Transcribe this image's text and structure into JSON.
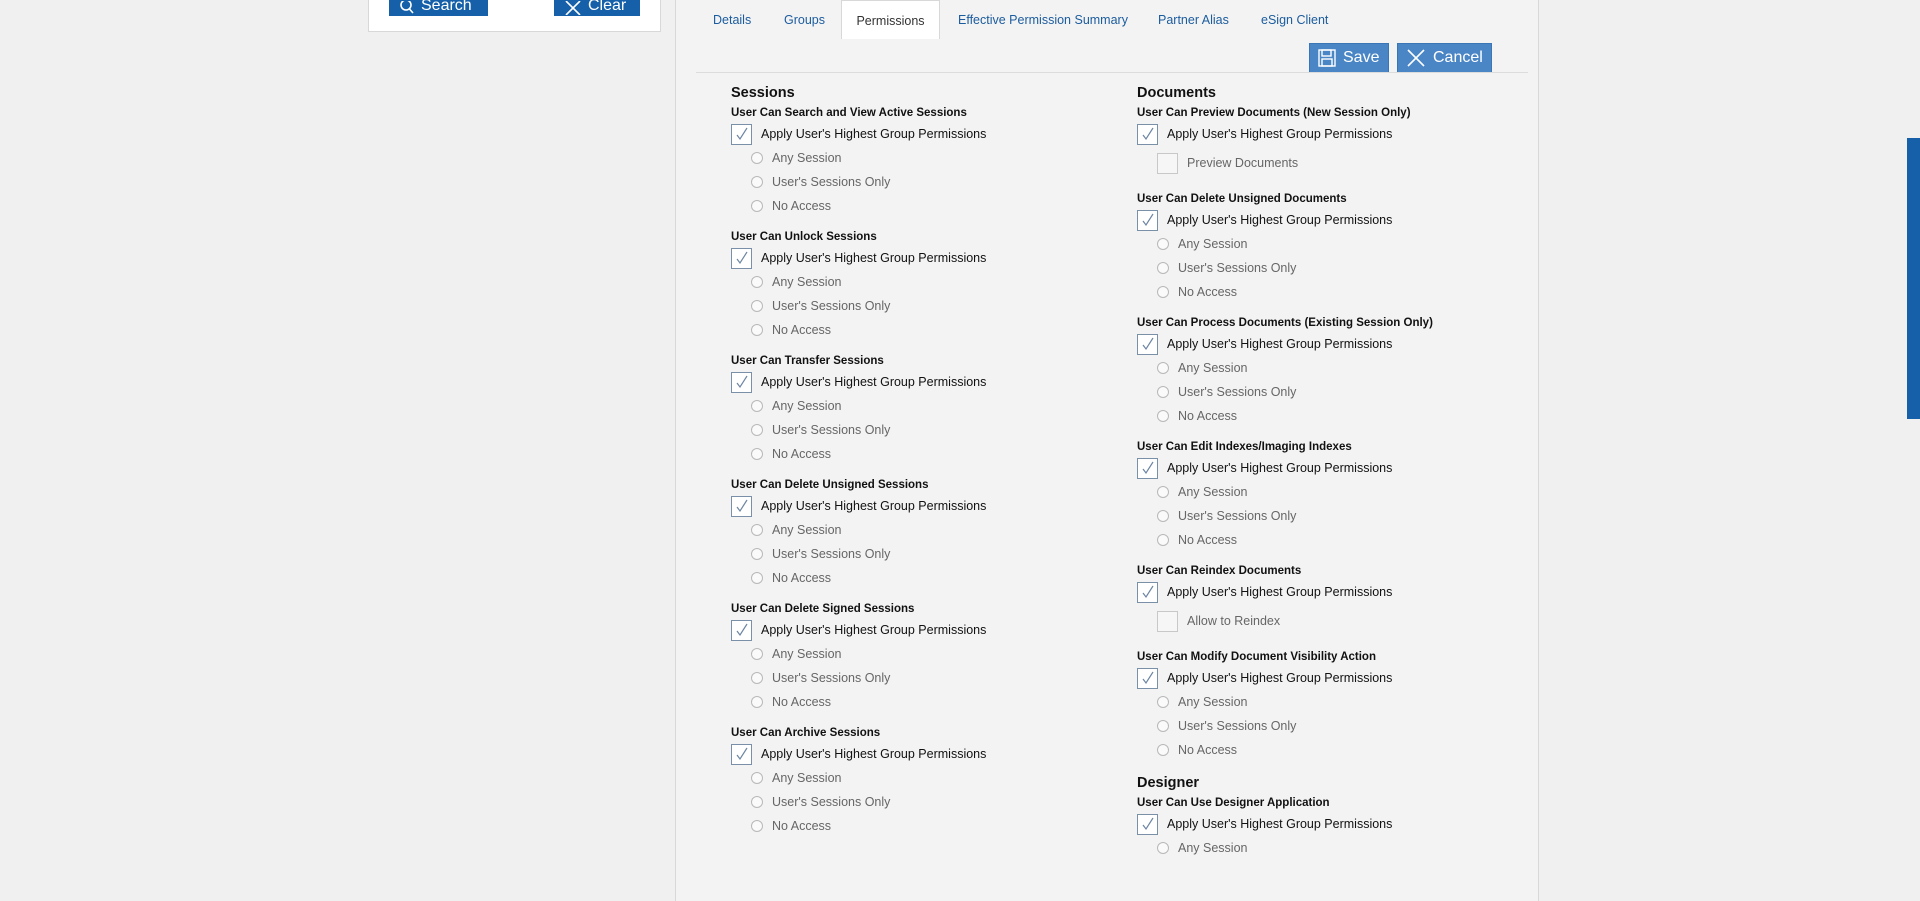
{
  "left_panel": {
    "search_label": "Search",
    "clear_label": "Clear"
  },
  "tabs": [
    {
      "label": "Details"
    },
    {
      "label": "Groups"
    },
    {
      "label": "Permissions"
    },
    {
      "label": "Effective Permission Summary"
    },
    {
      "label": "Partner Alias"
    },
    {
      "label": "eSign Client"
    }
  ],
  "actions": {
    "save_label": "Save",
    "cancel_label": "Cancel"
  },
  "common": {
    "apply_label": "Apply User's Highest Group Permissions",
    "any_session": "Any Session",
    "users_sessions_only": "User's Sessions Only",
    "no_access": "No Access"
  },
  "sessions": {
    "title": "Sessions",
    "items": [
      {
        "title": "User Can Search and View Active Sessions"
      },
      {
        "title": "User Can Unlock Sessions"
      },
      {
        "title": "User Can Transfer Sessions"
      },
      {
        "title": "User Can Delete Unsigned Sessions"
      },
      {
        "title": "User Can Delete Signed Sessions"
      },
      {
        "title": "User Can Archive Sessions"
      }
    ]
  },
  "documents": {
    "title": "Documents",
    "preview": {
      "title": "User Can Preview Documents (New Session Only)",
      "sub_label": "Preview Documents"
    },
    "delete_unsigned": {
      "title": "User Can Delete Unsigned Documents"
    },
    "process": {
      "title": "User Can Process Documents (Existing Session Only)"
    },
    "edit_indexes": {
      "title": "User Can Edit Indexes/Imaging Indexes"
    },
    "reindex": {
      "title": "User Can Reindex Documents",
      "sub_label": "Allow to Reindex"
    },
    "visibility": {
      "title": "User Can Modify Document Visibility Action"
    }
  },
  "designer": {
    "title": "Designer",
    "use_app": {
      "title": "User Can Use Designer Application"
    }
  }
}
